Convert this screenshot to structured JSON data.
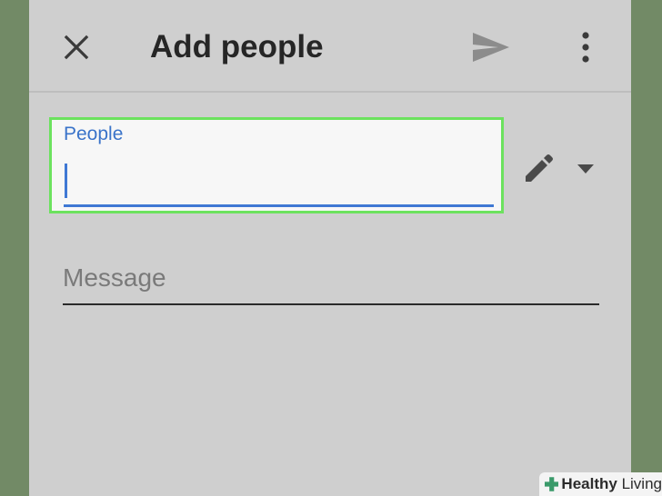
{
  "header": {
    "title": "Add people",
    "close_icon": "close-icon",
    "send_icon": "send-icon",
    "menu_icon": "more-vert-icon"
  },
  "people_field": {
    "label": "People",
    "value": "",
    "accent": "#3f78d4",
    "highlight": "#6ce25e"
  },
  "permission": {
    "edit_icon": "pencil-icon",
    "dropdown_icon": "caret-down-icon"
  },
  "message_field": {
    "placeholder": "Message"
  },
  "watermark": {
    "brand": "Healthy",
    "suffix": "Living"
  },
  "colors": {
    "page_bg": "#728a66",
    "screen_bg": "#cfcfcf"
  }
}
